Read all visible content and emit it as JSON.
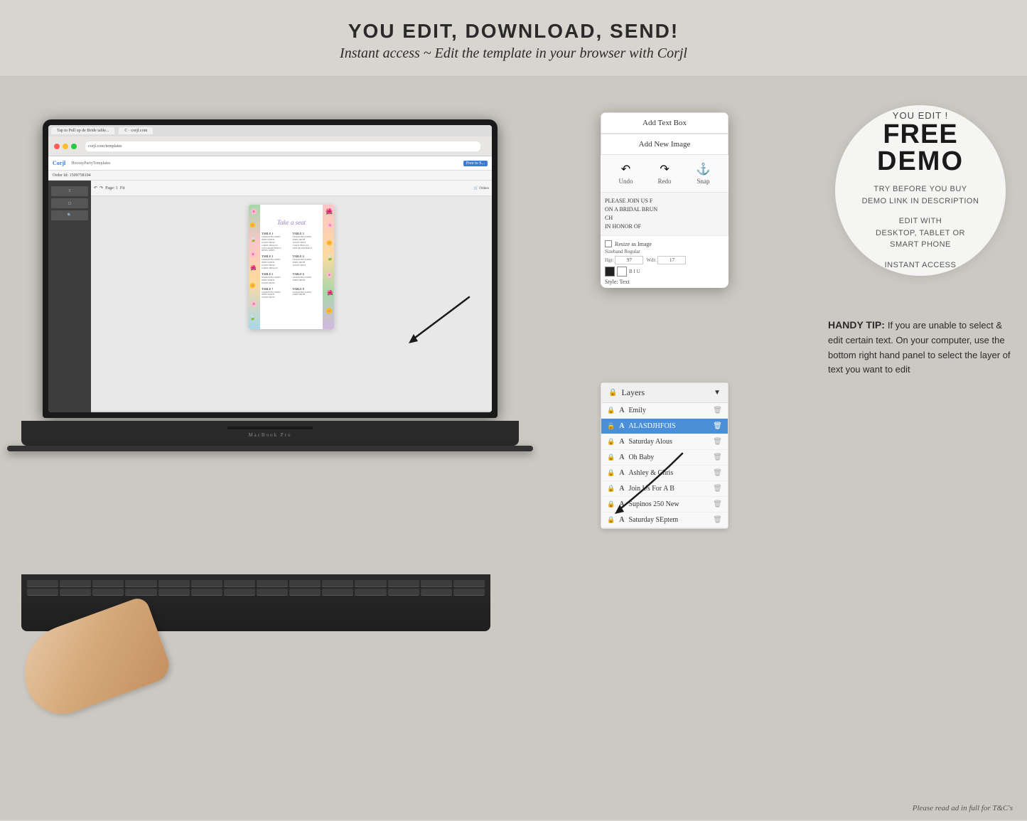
{
  "header": {
    "headline": "YOU EDIT, DOWNLOAD, SEND!",
    "subline": "Instant access ~ Edit the template in your browser with Corjl"
  },
  "demo_circle": {
    "you_edit": "YOU EDIT !",
    "free": "FREE",
    "demo": "DEMO",
    "line1": "TRY BEFORE YOU BUY",
    "line2": "DEMO LINK IN DESCRIPTION",
    "edit_label": "EDIT WITH",
    "devices": "DESKTOP, TABLET OR",
    "device2": "SMART PHONE",
    "instant": "INSTANT ACCESS"
  },
  "mobile_panel": {
    "btn1": "Add Text Box",
    "btn2": "Add New Image",
    "tool1": "Undo",
    "tool2": "Redo",
    "tool3": "Snap",
    "preview_text": "PLEASE JOIN US F\nON A BRIDAL BRUN\nCH\nIN HONOR OF",
    "checkbox_label": "Resize as Image",
    "size_label": "Sizeband Regular",
    "size_h": "97",
    "size_w": "17",
    "style_label": "Style: Text"
  },
  "layers_panel": {
    "header": "Layers",
    "items": [
      {
        "name": "Emily",
        "active": false
      },
      {
        "name": "ALASDJHFOIS",
        "active": true
      },
      {
        "name": "Saturday Alous",
        "active": false
      },
      {
        "name": "Oh Baby",
        "active": false
      },
      {
        "name": "Ashley & Chris",
        "active": false
      },
      {
        "name": "Join Us For A B",
        "active": false
      },
      {
        "name": "Supinos 250 New",
        "active": false
      },
      {
        "name": "Saturday SEptem",
        "active": false
      }
    ]
  },
  "handy_tip": {
    "title": "HANDY TIP:",
    "text": "If you are unable to select & edit certain text. On your computer, use the bottom right hand panel to select the layer of text you want to edit"
  },
  "corjl_editor": {
    "order_id": "Order Id: 1509758194",
    "canvas_title": "Take a seat",
    "tables": [
      {
        "label": "TABLE 1",
        "names": "SAMANTHA JONES\nJOHN SMITH\nJASON ORTIZ\nCAROL BRAGGS\nTAYLOR MICHAELS\nDENIS JONES\nPETER SIMS"
      },
      {
        "label": "TABLE 2",
        "names": "SAMANTHA JONES\nJOHN SMITH\nJASON ORTIZ\nCAROL BRAGGS\nTAYLOR MICHAELS"
      },
      {
        "label": "TABLE 3",
        "names": "SAMANTHA JONES\nJOHN SMITH\nJASON ORTIZ"
      },
      {
        "label": "TABLE 4",
        "names": "SAMANTHA JONES\nJOHN SMITH"
      },
      {
        "label": "TABLE 5",
        "names": "SAMANTHA JONES\nJOHN SMITH\nJASON ORTIZ"
      },
      {
        "label": "TABLE 6",
        "names": "SAMANTHA JONES\nJOHN SMITH"
      }
    ]
  },
  "footer": {
    "text": "Please read ad in full for T&C's"
  }
}
